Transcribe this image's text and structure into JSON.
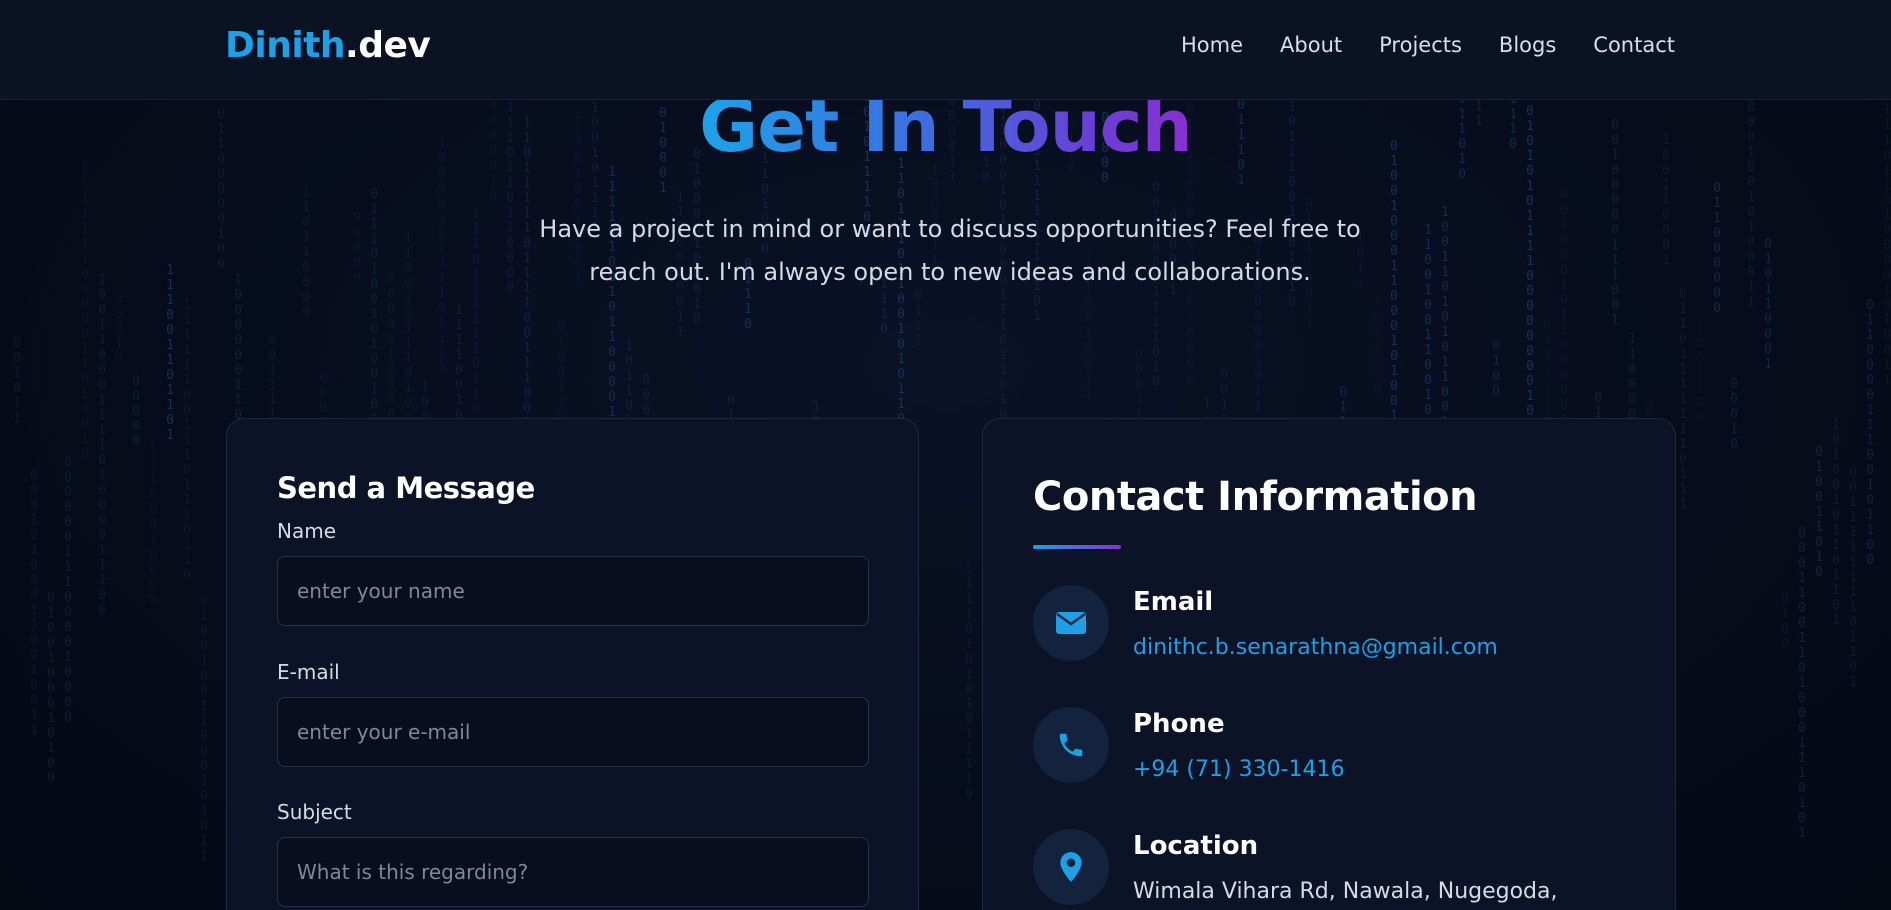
{
  "nav": {
    "logo_accent": "Dinith",
    "logo_rest": ".dev",
    "links": [
      "Home",
      "About",
      "Projects",
      "Blogs",
      "Contact"
    ]
  },
  "hero": {
    "title": "Get In Touch",
    "subtitle": "Have a project in mind or want to discuss opportunities? Feel free to reach out. I'm always open to new ideas and collaborations."
  },
  "form": {
    "title": "Send a Message",
    "fields": [
      {
        "label": "Name",
        "placeholder": "enter your name",
        "value": ""
      },
      {
        "label": "E-mail",
        "placeholder": "enter your e-mail",
        "value": ""
      },
      {
        "label": "Subject",
        "placeholder": "What is this regarding?",
        "value": ""
      }
    ]
  },
  "contact": {
    "title": "Contact Information",
    "items": [
      {
        "label": "Email",
        "value": "dinithc.b.senarathna@gmail.com",
        "icon": "envelope-icon"
      },
      {
        "label": "Phone",
        "value": "+94 (71) 330-1416",
        "icon": "phone-icon"
      },
      {
        "label": "Location",
        "value": "Wimala Vihara Rd, Nawala, Nugegoda,",
        "icon": "map-pin-icon"
      }
    ]
  },
  "colors": {
    "background": "#050b18",
    "navbar": "#0b1224",
    "card": "#0c1326",
    "accent_blue": "#1ea0e6",
    "accent_purple": "#8a2fd0"
  },
  "background_pattern": "binary-rain"
}
